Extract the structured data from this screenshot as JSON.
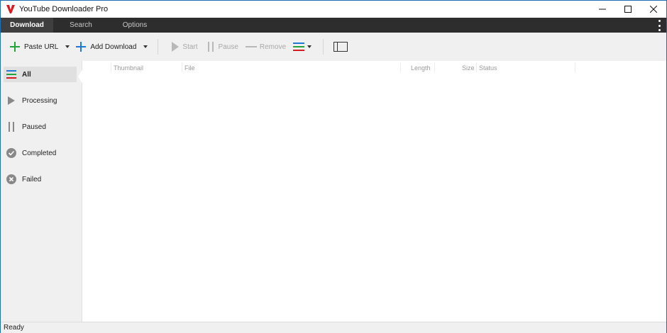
{
  "window": {
    "title": "YouTube Downloader Pro",
    "controls": [
      "minimize-icon",
      "maximize-icon",
      "close-icon"
    ]
  },
  "tabs": [
    {
      "label": "Download",
      "active": true
    },
    {
      "label": "Search",
      "active": false
    },
    {
      "label": "Options",
      "active": false
    }
  ],
  "toolbar": {
    "paste_url": "Paste URL",
    "add_download": "Add Download",
    "start": "Start",
    "pause": "Pause",
    "remove": "Remove"
  },
  "sidebar": {
    "items": [
      {
        "label": "All",
        "icon": "list-icon",
        "active": true
      },
      {
        "label": "Processing",
        "icon": "play-icon",
        "active": false
      },
      {
        "label": "Paused",
        "icon": "pause-icon",
        "active": false
      },
      {
        "label": "Completed",
        "icon": "check-circle-icon",
        "active": false
      },
      {
        "label": "Failed",
        "icon": "x-circle-icon",
        "active": false
      }
    ]
  },
  "table": {
    "columns": [
      "Thumbnail",
      "File",
      "Length",
      "Size",
      "Status"
    ],
    "rows": []
  },
  "status": {
    "text": "Ready"
  },
  "colors": {
    "brand_red": "#d71920",
    "accent_blue": "#1e78d6",
    "accent_green": "#23a43a",
    "tab_bar": "#2d2d2d"
  }
}
